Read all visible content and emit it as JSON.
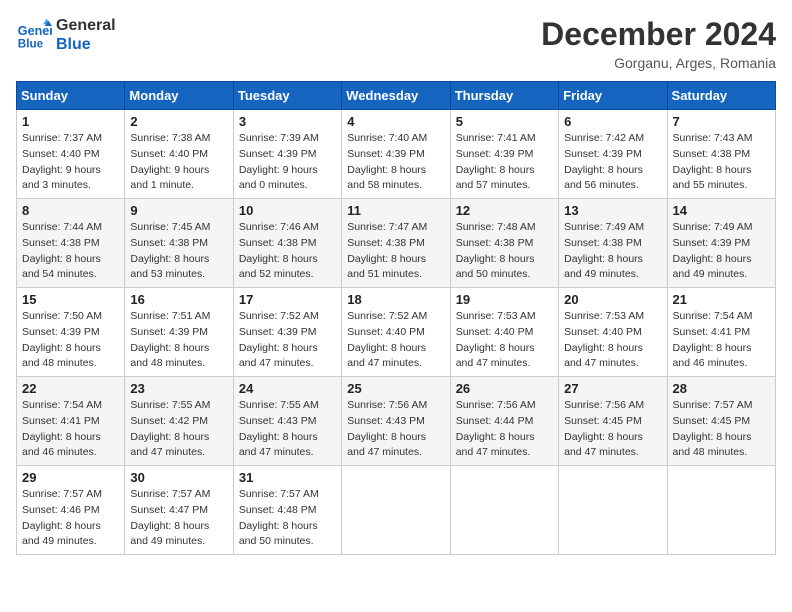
{
  "header": {
    "logo_line1": "General",
    "logo_line2": "Blue",
    "month": "December 2024",
    "location": "Gorganu, Arges, Romania"
  },
  "weekdays": [
    "Sunday",
    "Monday",
    "Tuesday",
    "Wednesday",
    "Thursday",
    "Friday",
    "Saturday"
  ],
  "weeks": [
    [
      {
        "day": "1",
        "sunrise": "7:37 AM",
        "sunset": "4:40 PM",
        "daylight": "9 hours and 3 minutes."
      },
      {
        "day": "2",
        "sunrise": "7:38 AM",
        "sunset": "4:40 PM",
        "daylight": "9 hours and 1 minute."
      },
      {
        "day": "3",
        "sunrise": "7:39 AM",
        "sunset": "4:39 PM",
        "daylight": "9 hours and 0 minutes."
      },
      {
        "day": "4",
        "sunrise": "7:40 AM",
        "sunset": "4:39 PM",
        "daylight": "8 hours and 58 minutes."
      },
      {
        "day": "5",
        "sunrise": "7:41 AM",
        "sunset": "4:39 PM",
        "daylight": "8 hours and 57 minutes."
      },
      {
        "day": "6",
        "sunrise": "7:42 AM",
        "sunset": "4:39 PM",
        "daylight": "8 hours and 56 minutes."
      },
      {
        "day": "7",
        "sunrise": "7:43 AM",
        "sunset": "4:38 PM",
        "daylight": "8 hours and 55 minutes."
      }
    ],
    [
      {
        "day": "8",
        "sunrise": "7:44 AM",
        "sunset": "4:38 PM",
        "daylight": "8 hours and 54 minutes."
      },
      {
        "day": "9",
        "sunrise": "7:45 AM",
        "sunset": "4:38 PM",
        "daylight": "8 hours and 53 minutes."
      },
      {
        "day": "10",
        "sunrise": "7:46 AM",
        "sunset": "4:38 PM",
        "daylight": "8 hours and 52 minutes."
      },
      {
        "day": "11",
        "sunrise": "7:47 AM",
        "sunset": "4:38 PM",
        "daylight": "8 hours and 51 minutes."
      },
      {
        "day": "12",
        "sunrise": "7:48 AM",
        "sunset": "4:38 PM",
        "daylight": "8 hours and 50 minutes."
      },
      {
        "day": "13",
        "sunrise": "7:49 AM",
        "sunset": "4:38 PM",
        "daylight": "8 hours and 49 minutes."
      },
      {
        "day": "14",
        "sunrise": "7:49 AM",
        "sunset": "4:39 PM",
        "daylight": "8 hours and 49 minutes."
      }
    ],
    [
      {
        "day": "15",
        "sunrise": "7:50 AM",
        "sunset": "4:39 PM",
        "daylight": "8 hours and 48 minutes."
      },
      {
        "day": "16",
        "sunrise": "7:51 AM",
        "sunset": "4:39 PM",
        "daylight": "8 hours and 48 minutes."
      },
      {
        "day": "17",
        "sunrise": "7:52 AM",
        "sunset": "4:39 PM",
        "daylight": "8 hours and 47 minutes."
      },
      {
        "day": "18",
        "sunrise": "7:52 AM",
        "sunset": "4:40 PM",
        "daylight": "8 hours and 47 minutes."
      },
      {
        "day": "19",
        "sunrise": "7:53 AM",
        "sunset": "4:40 PM",
        "daylight": "8 hours and 47 minutes."
      },
      {
        "day": "20",
        "sunrise": "7:53 AM",
        "sunset": "4:40 PM",
        "daylight": "8 hours and 47 minutes."
      },
      {
        "day": "21",
        "sunrise": "7:54 AM",
        "sunset": "4:41 PM",
        "daylight": "8 hours and 46 minutes."
      }
    ],
    [
      {
        "day": "22",
        "sunrise": "7:54 AM",
        "sunset": "4:41 PM",
        "daylight": "8 hours and 46 minutes."
      },
      {
        "day": "23",
        "sunrise": "7:55 AM",
        "sunset": "4:42 PM",
        "daylight": "8 hours and 47 minutes."
      },
      {
        "day": "24",
        "sunrise": "7:55 AM",
        "sunset": "4:43 PM",
        "daylight": "8 hours and 47 minutes."
      },
      {
        "day": "25",
        "sunrise": "7:56 AM",
        "sunset": "4:43 PM",
        "daylight": "8 hours and 47 minutes."
      },
      {
        "day": "26",
        "sunrise": "7:56 AM",
        "sunset": "4:44 PM",
        "daylight": "8 hours and 47 minutes."
      },
      {
        "day": "27",
        "sunrise": "7:56 AM",
        "sunset": "4:45 PM",
        "daylight": "8 hours and 47 minutes."
      },
      {
        "day": "28",
        "sunrise": "7:57 AM",
        "sunset": "4:45 PM",
        "daylight": "8 hours and 48 minutes."
      }
    ],
    [
      {
        "day": "29",
        "sunrise": "7:57 AM",
        "sunset": "4:46 PM",
        "daylight": "8 hours and 49 minutes."
      },
      {
        "day": "30",
        "sunrise": "7:57 AM",
        "sunset": "4:47 PM",
        "daylight": "8 hours and 49 minutes."
      },
      {
        "day": "31",
        "sunrise": "7:57 AM",
        "sunset": "4:48 PM",
        "daylight": "8 hours and 50 minutes."
      },
      null,
      null,
      null,
      null
    ]
  ]
}
